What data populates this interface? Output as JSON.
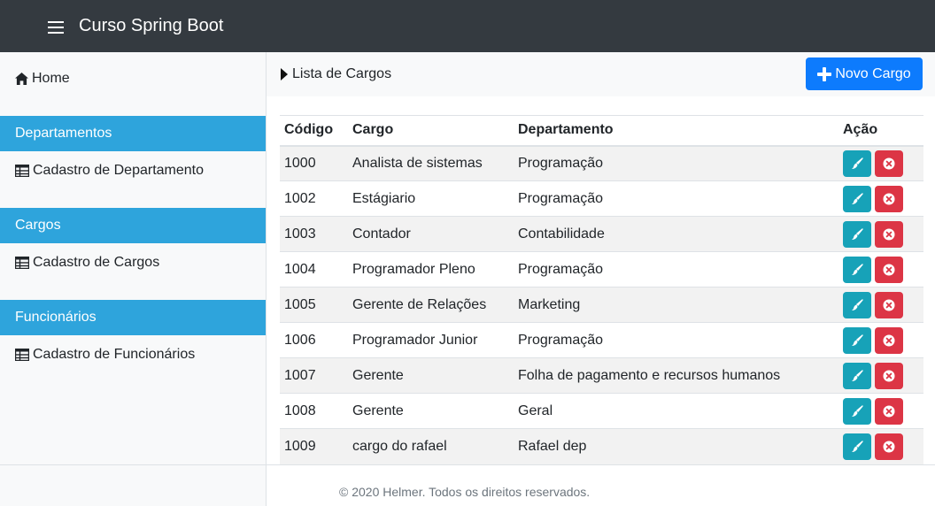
{
  "navbar": {
    "brand": "Curso Spring Boot",
    "menu_icon": "hamburger-menu-icon"
  },
  "sidebar": {
    "home": {
      "label": "Home",
      "icon": "home-icon"
    },
    "sections": [
      {
        "header": "Departamentos",
        "link": "Cadastro de Departamento",
        "icon": "table-icon"
      },
      {
        "header": "Cargos",
        "link": "Cadastro de Cargos",
        "icon": "table-icon"
      },
      {
        "header": "Funcionários",
        "link": "Cadastro de Funcionários",
        "icon": "table-icon"
      }
    ]
  },
  "main": {
    "breadcrumb": "Lista de Cargos",
    "new_button": "Novo Cargo",
    "table": {
      "headers": [
        "Código",
        "Cargo",
        "Departamento",
        "Ação"
      ],
      "rows": [
        {
          "codigo": "1000",
          "cargo": "Analista de sistemas",
          "departamento": "Programação"
        },
        {
          "codigo": "1002",
          "cargo": "Estágiario",
          "departamento": "Programação"
        },
        {
          "codigo": "1003",
          "cargo": "Contador",
          "departamento": "Contabilidade"
        },
        {
          "codigo": "1004",
          "cargo": "Programador Pleno",
          "departamento": "Programação"
        },
        {
          "codigo": "1005",
          "cargo": "Gerente de Relações",
          "departamento": "Marketing"
        },
        {
          "codigo": "1006",
          "cargo": "Programador Junior",
          "departamento": "Programação"
        },
        {
          "codigo": "1007",
          "cargo": "Gerente",
          "departamento": "Folha de pagamento e recursos humanos"
        },
        {
          "codigo": "1008",
          "cargo": "Gerente",
          "departamento": "Geral"
        },
        {
          "codigo": "1009",
          "cargo": "cargo do rafael",
          "departamento": "Rafael dep"
        }
      ]
    }
  },
  "footer": {
    "text": "© 2020 Helmer. Todos os direitos reservados."
  },
  "colors": {
    "navbar": "#343a40",
    "section_header": "#2ea4dc",
    "primary": "#0d7bfd",
    "edit": "#17a2b8",
    "delete": "#dc3545"
  }
}
